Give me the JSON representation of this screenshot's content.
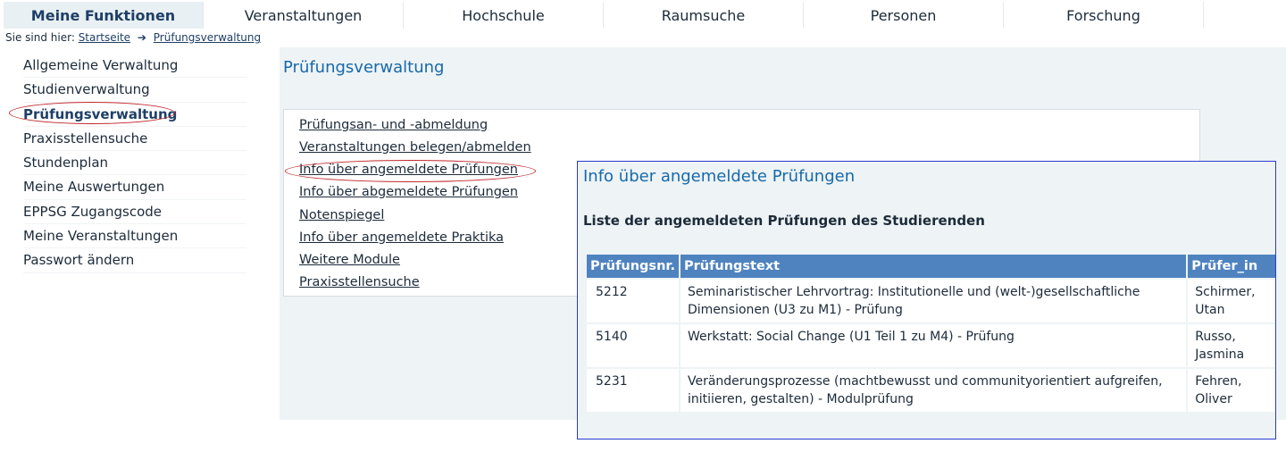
{
  "nav": {
    "tabs": [
      "Meine Funktionen",
      "Veranstaltungen",
      "Hochschule",
      "Raumsuche",
      "Personen",
      "Forschung"
    ],
    "active_index": 0
  },
  "breadcrumb": {
    "prefix": "Sie sind hier:",
    "items": [
      "Startseite",
      "Prüfungsverwaltung"
    ],
    "separator": "➔"
  },
  "sidebar": {
    "items": [
      "Allgemeine Verwaltung",
      "Studienverwaltung",
      "Prüfungsverwaltung",
      "Praxisstellensuche",
      "Stundenplan",
      "Meine Auswertungen",
      "EPPSG Zugangscode",
      "Meine Veranstaltungen",
      "Passwort ändern"
    ],
    "active_index": 2
  },
  "main": {
    "title": "Prüfungsverwaltung",
    "links": [
      "Prüfungsan- und -abmeldung",
      "Veranstaltungen belegen/abmelden",
      "Info über angemeldete Prüfungen",
      "Info über abgemeldete Prüfungen",
      "Notenspiegel",
      "Info über angemeldete Praktika",
      "Weitere Module",
      "Praxisstellensuche"
    ]
  },
  "popup": {
    "title": "Info über angemeldete Prüfungen",
    "subtitle": "Liste der angemeldeten Prüfungen des Studierenden",
    "columns": [
      "Prüfungsnr.",
      "Prüfungstext",
      "Prüfer_in"
    ],
    "rows": [
      {
        "nr": "5212",
        "text": "Seminaristischer Lehrvortrag: Institutionelle und (welt-)gesellschaftliche Dimensionen (U3 zu M1) - Prüfung",
        "examiner": "Schirmer, Utan"
      },
      {
        "nr": "5140",
        "text": "Werkstatt: Social Change (U1 Teil 1 zu M4) - Prüfung",
        "examiner": "Russo, Jasmina"
      },
      {
        "nr": "5231",
        "text": "Veränderungsprozesse (machtbewusst und communityorientiert aufgreifen, initiieren, gestalten) - Modulprüfung",
        "examiner": "Fehren, Oliver"
      }
    ]
  },
  "colors": {
    "accent_blue": "#1769aa",
    "header_blue": "#4f83bf",
    "highlight_red": "#c0262c",
    "popup_border": "#2a3ad0"
  }
}
